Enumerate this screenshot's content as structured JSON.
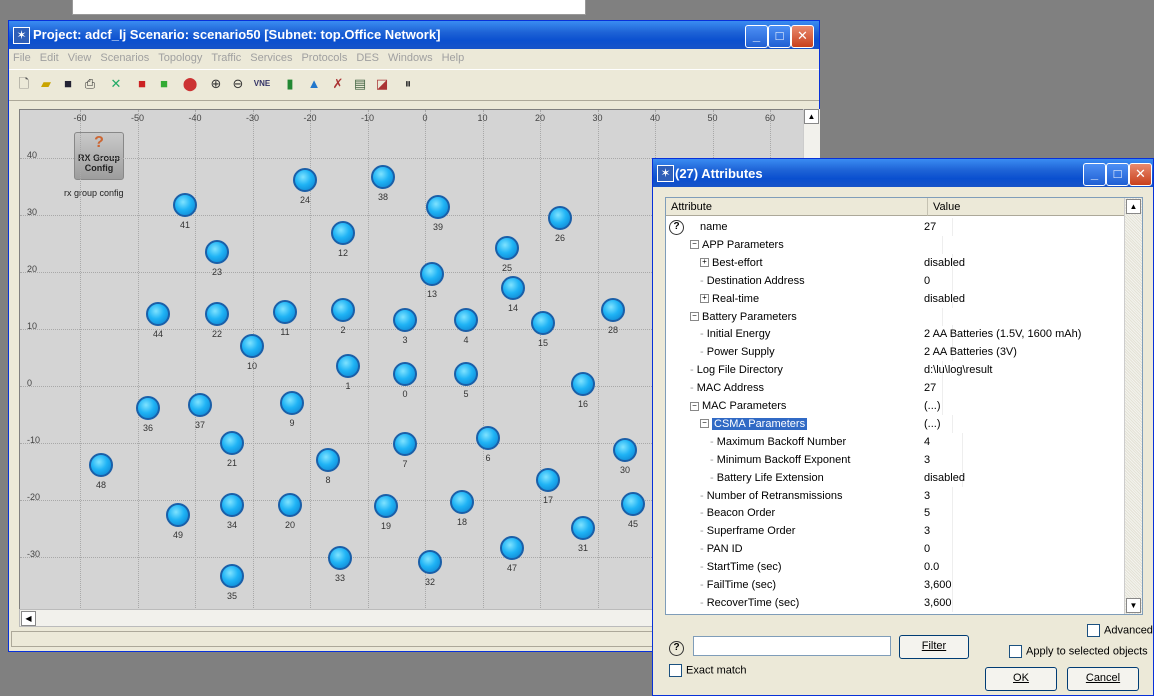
{
  "main": {
    "title": "Project: adcf_lj Scenario: scenario50  [Subnet: top.Office Network]",
    "menu": [
      "File",
      "Edit",
      "View",
      "Scenarios",
      "Topology",
      "Traffic",
      "Services",
      "Protocols",
      "DES",
      "Windows",
      "Help"
    ],
    "toolbar_icons": [
      "new-icon",
      "open-icon",
      "save-icon",
      "print-icon",
      "node-palette-icon",
      "object-icon",
      "object2-icon",
      "failure-icon",
      "zoom-in-icon",
      "zoom-out-icon",
      "vne-icon",
      "bar-icon",
      "triangle-icon",
      "pin-icon",
      "report-icon",
      "graph-icon",
      "pause-icon"
    ],
    "x_ticks": [
      "-60",
      "-50",
      "-40",
      "-30",
      "-20",
      "-10",
      "0",
      "10",
      "20",
      "30",
      "40",
      "50",
      "60"
    ],
    "y_ticks": [
      "40",
      "30",
      "20",
      "10",
      "0",
      "-10",
      "-20",
      "-30"
    ],
    "rx_icon_label": "RX Group Config",
    "rx_caption": "rx group config",
    "nodes": [
      "41",
      "24",
      "38",
      "39",
      "12",
      "26",
      "23",
      "25",
      "13",
      "14",
      "44",
      "22",
      "11",
      "2",
      "3",
      "4",
      "15",
      "28",
      "10",
      "1",
      "0",
      "5",
      "16",
      "36",
      "37",
      "9",
      "6",
      "21",
      "8",
      "7",
      "48",
      "30",
      "17",
      "49",
      "34",
      "20",
      "19",
      "18",
      "45",
      "33",
      "32",
      "47",
      "31",
      "35"
    ]
  },
  "dialog": {
    "title": "(27) Attributes",
    "col_attribute": "Attribute",
    "col_value": "Value",
    "rows": [
      {
        "attr": "name",
        "value": "27"
      },
      {
        "attr": "APP Parameters",
        "value": ""
      },
      {
        "attr": "Best-effort",
        "value": "disabled"
      },
      {
        "attr": "Destination Address",
        "value": "0"
      },
      {
        "attr": "Real-time",
        "value": "disabled"
      },
      {
        "attr": "Battery Parameters",
        "value": ""
      },
      {
        "attr": "Initial Energy",
        "value": "2 AA Batteries (1.5V, 1600 mAh)"
      },
      {
        "attr": "Power Supply",
        "value": "2 AA Batteries (3V)"
      },
      {
        "attr": "Log File Directory",
        "value": "d:\\lu\\log\\result"
      },
      {
        "attr": "MAC Address",
        "value": "27"
      },
      {
        "attr": "MAC Parameters",
        "value": "(...)"
      },
      {
        "attr": "CSMA Parameters",
        "value": "(...)"
      },
      {
        "attr": "Maximum Backoff Number",
        "value": "4"
      },
      {
        "attr": "Minimum Backoff Exponent",
        "value": "3"
      },
      {
        "attr": "Battery Life Extension",
        "value": "disabled"
      },
      {
        "attr": "Number of Retransmissions",
        "value": "3"
      },
      {
        "attr": "Beacon Order",
        "value": "5"
      },
      {
        "attr": "Superframe Order",
        "value": "3"
      },
      {
        "attr": "PAN ID",
        "value": "0"
      },
      {
        "attr": "StartTime (sec)",
        "value": "0.0"
      },
      {
        "attr": "FailTime (sec)",
        "value": "3,600"
      },
      {
        "attr": "RecoverTime (sec)",
        "value": "3,600"
      }
    ],
    "filter_button": "Filter",
    "search_value": "",
    "advanced_label": "Advanced",
    "apply_label": "Apply to selected objects",
    "exact_match_label": "Exact match",
    "ok_label": "OK",
    "cancel_label": "Cancel"
  }
}
